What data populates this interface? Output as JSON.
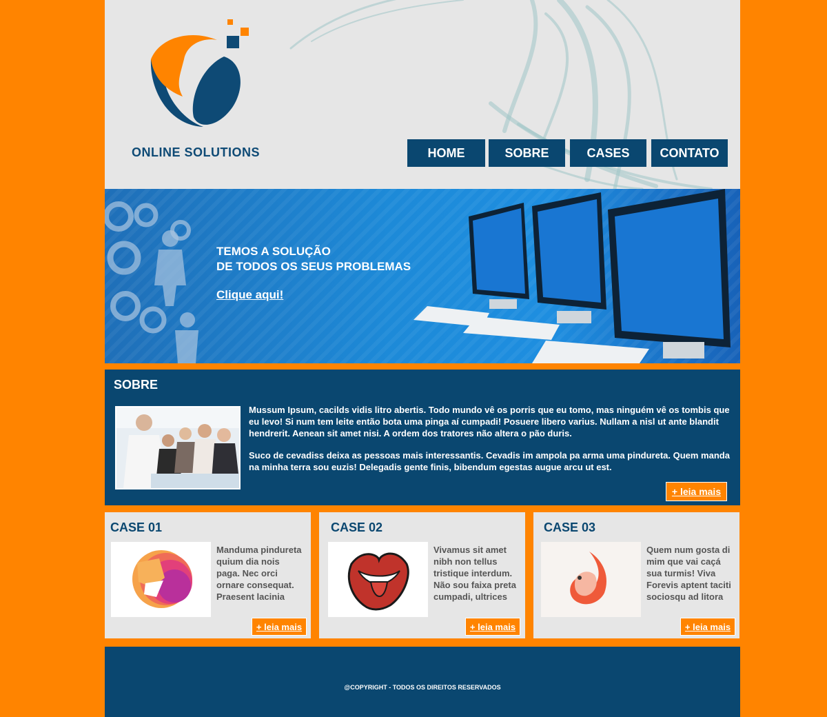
{
  "brand": {
    "name": "ONLINE SOLUTIONS"
  },
  "nav": [
    {
      "label": "HOME"
    },
    {
      "label": "SOBRE"
    },
    {
      "label": "CASES"
    },
    {
      "label": "CONTATO"
    }
  ],
  "banner": {
    "line1": "TEMOS A SOLUÇÃO",
    "line2": "DE TODOS OS SEUS PROBLEMAS",
    "link": "Clique aqui!"
  },
  "sobre": {
    "title": "SOBRE",
    "p1": "Mussum Ipsum, cacilds vidis litro abertis. Todo mundo vê os porris que eu tomo, mas ninguém vê os tombis que eu levo! Si num tem leite então bota uma pinga aí cumpadi! Posuere libero varius. Nullam a nisl ut ante blandit hendrerit. Aenean sit amet nisi. A ordem dos tratores não altera o pão duris.",
    "p2": "Suco de cevadiss deixa as pessoas mais interessantis. Cevadis im ampola pa arma uma pindureta. Quem manda na minha terra sou euzis! Delegadis gente finis, bibendum egestas augue arcu ut est.",
    "more": "+ leia mais"
  },
  "cases": [
    {
      "title": "CASE 01",
      "text": "Manduma pindureta quium dia nois paga. Nec orci ornare consequat. Praesent lacinia",
      "more": "+ leia mais"
    },
    {
      "title": "CASE 02",
      "text": "Vivamus sit amet nibh non tellus tristique interdum. Não sou faixa preta cumpadi, ultrices",
      "more": "+ leia mais"
    },
    {
      "title": "CASE 03",
      "text": "Quem num gosta di mim que vai caçá sua turmis! Viva Forevis aptent taciti sociosqu ad litora",
      "more": "+ leia mais"
    }
  ],
  "footer": {
    "copyright": "@COPYRIGHT - TODOS OS DIREITOS RESERVADOS"
  },
  "colors": {
    "orange": "#ff8400",
    "navy": "#0a4770",
    "light_gray": "#e6e6e6"
  },
  "icons": [
    "company-logo-icon",
    "gears-illustration-icon",
    "computers-illustration-icon",
    "lion-logo-icon",
    "lips-logo-icon",
    "bird-logo-icon"
  ]
}
